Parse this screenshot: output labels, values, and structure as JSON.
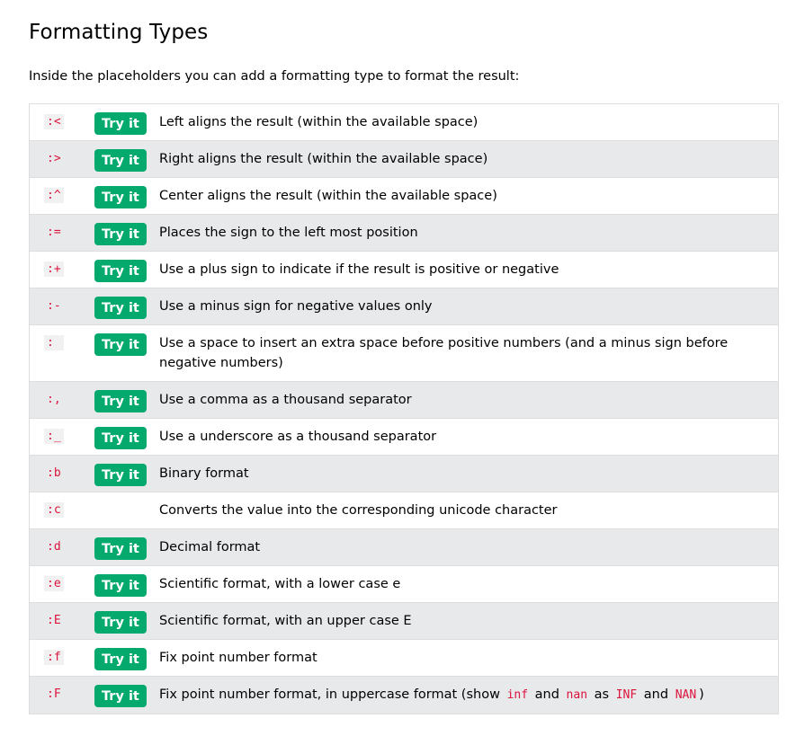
{
  "heading": "Formatting Types",
  "intro": "Inside the placeholders you can add a formatting type to format the result:",
  "accent_color": "#04aa6d",
  "code_color": "#dc143c",
  "try_label": "Try it",
  "rows": [
    {
      "code": ":<",
      "has_try": true,
      "desc": "Left aligns the result (within the available space)"
    },
    {
      "code": ":>",
      "has_try": true,
      "desc": "Right aligns the result (within the available space)"
    },
    {
      "code": ":^",
      "has_try": true,
      "desc": "Center aligns the result (within the available space)"
    },
    {
      "code": ":=",
      "has_try": true,
      "desc": "Places the sign to the left most position"
    },
    {
      "code": ":+",
      "has_try": true,
      "desc": "Use a plus sign to indicate if the result is positive or negative"
    },
    {
      "code": ":-",
      "has_try": true,
      "desc": "Use a minus sign for negative values only"
    },
    {
      "code": ": ",
      "has_try": true,
      "desc": "Use a space to insert an extra space before positive numbers (and a minus sign before negative numbers)"
    },
    {
      "code": ":,",
      "has_try": true,
      "desc": "Use a comma as a thousand separator"
    },
    {
      "code": ":_",
      "has_try": true,
      "desc": "Use a underscore as a thousand separator"
    },
    {
      "code": ":b",
      "has_try": true,
      "desc": "Binary format"
    },
    {
      "code": ":c",
      "has_try": false,
      "desc": "Converts the value into the corresponding unicode character"
    },
    {
      "code": ":d",
      "has_try": true,
      "desc": "Decimal format"
    },
    {
      "code": ":e",
      "has_try": true,
      "desc": "Scientific format, with a lower case e"
    },
    {
      "code": ":E",
      "has_try": true,
      "desc": "Scientific format, with an upper case E"
    },
    {
      "code": ":f",
      "has_try": true,
      "desc": "Fix point number format"
    },
    {
      "code": ":F",
      "has_try": true,
      "desc_parts": [
        {
          "t": "Fix point number format, in uppercase format (show "
        },
        {
          "c": "inf"
        },
        {
          "t": " and "
        },
        {
          "c": "nan"
        },
        {
          "t": " as "
        },
        {
          "c": "INF"
        },
        {
          "t": " and "
        },
        {
          "c": "NAN"
        },
        {
          "t": ")"
        }
      ]
    }
  ]
}
